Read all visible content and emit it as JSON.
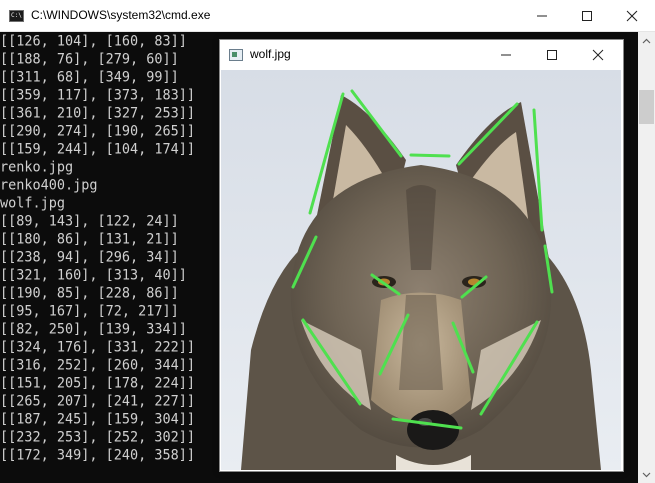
{
  "cmd_window": {
    "title": "C:\\WINDOWS\\system32\\cmd.exe",
    "icon_text": "C:\\",
    "console_lines": [
      "[[126, 104], [160, 83]]",
      "[[188, 76], [279, 60]]",
      "[[311, 68], [349, 99]]",
      "[[359, 117], [373, 183]]",
      "[[361, 210], [327, 253]]",
      "[[290, 274], [190, 265]]",
      "[[159, 244], [104, 174]]",
      "renko.jpg",
      "renko400.jpg",
      "wolf.jpg",
      "[[89, 143], [122, 24]]",
      "[[180, 86], [131, 21]]",
      "[[238, 94], [296, 34]]",
      "[[321, 160], [313, 40]]",
      "[[190, 85], [228, 86]]",
      "[[95, 167], [72, 217]]",
      "[[82, 250], [139, 334]]",
      "[[324, 176], [331, 222]]",
      "[[316, 252], [260, 344]]",
      "[[151, 205], [178, 224]]",
      "[[265, 207], [241, 227]]",
      "[[187, 245], [159, 304]]",
      "[[232, 253], [252, 302]]",
      "[[172, 349], [240, 358]]"
    ]
  },
  "image_window": {
    "title": "wolf.jpg",
    "line_color": "#4fe04f"
  }
}
